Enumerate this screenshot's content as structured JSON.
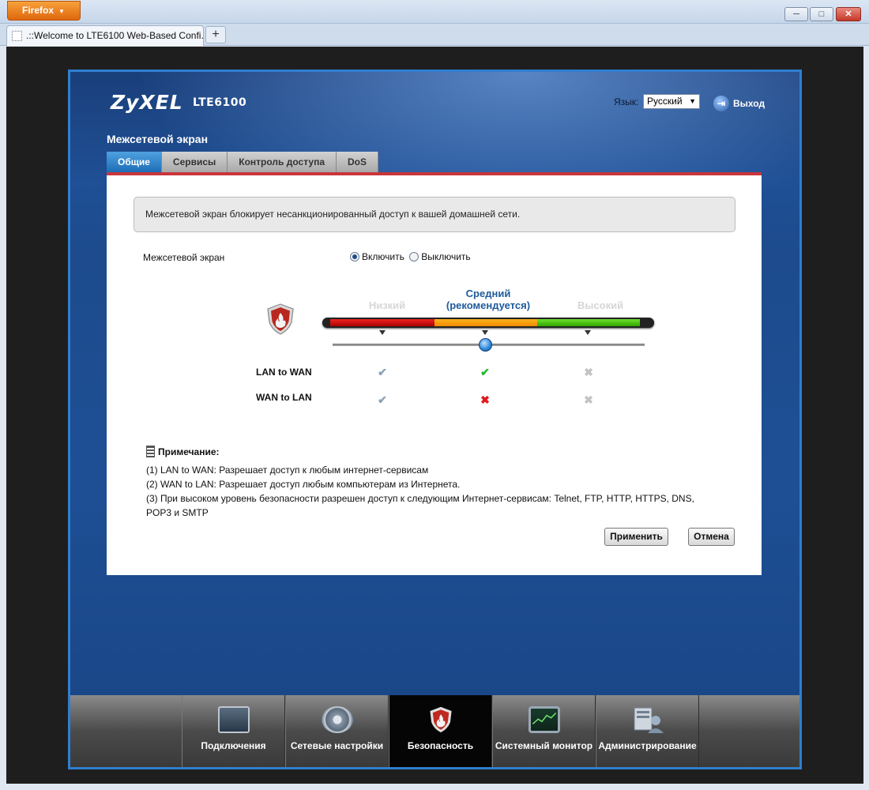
{
  "browser": {
    "menu_label": "Firefox",
    "tab_title": ".::Welcome to LTE6100 Web-Based Confi...",
    "new_tab": "+",
    "win_min": "─",
    "win_max": "□",
    "win_close": "✕"
  },
  "header": {
    "logo": "ZyXEL",
    "model": "LTE6100",
    "language_label": "Язык:",
    "language_value": "Русский",
    "logout_label": "Выход"
  },
  "page": {
    "title": "Межсетевой экран",
    "tabs": [
      {
        "label": "Общие",
        "active": true
      },
      {
        "label": "Сервисы",
        "active": false
      },
      {
        "label": "Контроль доступа",
        "active": false
      },
      {
        "label": "DoS",
        "active": false
      }
    ],
    "info_text": "Межсетевой экран блокирует несанкционированный доступ к вашей домашней сети.",
    "firewall_label": "Межсетевой экран",
    "radio_enable": "Включить",
    "radio_disable": "Выключить",
    "firewall_enabled": true
  },
  "security_levels": {
    "low": "Низкий",
    "medium_line1": "Средний",
    "medium_line2": "(рекомендуется)",
    "high": "Высокий",
    "selected": "medium",
    "colors": {
      "low": "#cc1111",
      "medium": "#f7a000",
      "high": "#3cbf10",
      "selected_text": "#1f5a9c",
      "inactive_text": "#d6d6d6"
    }
  },
  "matrix": {
    "rows": [
      {
        "label": "LAN to WAN",
        "low": "check-gray",
        "medium": "check-green",
        "high": "cross-gray"
      },
      {
        "label": "WAN to LAN",
        "low": "check-gray",
        "medium": "cross-red",
        "high": "cross-gray"
      }
    ]
  },
  "note": {
    "title": "Примечание:",
    "lines": [
      "(1) LAN to WAN: Разрешает доступ к любым интернет-сервисам",
      "(2) WAN to LAN: Разрешает доступ любым компьютерам из Интернета.",
      "(3) При высоком уровень безопасности разрешен доступ к следующим Интернет-сервисам: Telnet, FTP, HTTP, HTTPS, DNS, POP3 и SMTP"
    ]
  },
  "buttons": {
    "apply": "Применить",
    "cancel": "Отмена"
  },
  "bottom_nav": [
    {
      "label": "Подключения",
      "icon": "connections-icon",
      "active": false
    },
    {
      "label": "Сетевые настройки",
      "icon": "network-settings-icon",
      "active": false
    },
    {
      "label": "Безопасность",
      "icon": "security-icon",
      "active": true
    },
    {
      "label": "Системный монитор",
      "icon": "system-monitor-icon",
      "active": false
    },
    {
      "label": "Администрирование",
      "icon": "administration-icon",
      "active": false
    }
  ]
}
